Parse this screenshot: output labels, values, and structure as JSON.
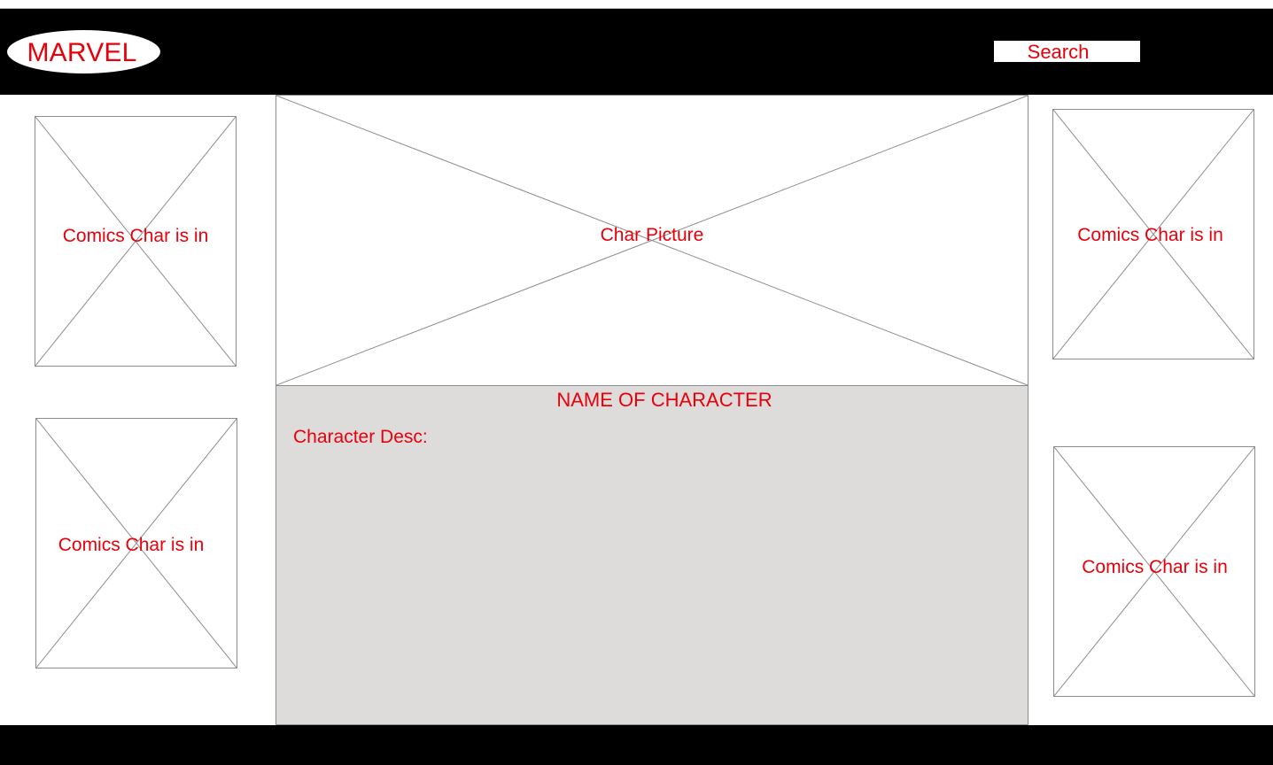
{
  "header": {
    "logo_text": "MARVEL",
    "search_label": "Search"
  },
  "comics": {
    "left_top": "Comics Char is in",
    "left_bottom": "Comics Char is in",
    "right_top": "Comics Char is in",
    "right_bottom": "Comics Char is in"
  },
  "character": {
    "picture_label": "Char Picture",
    "name": "NAME OF CHARACTER",
    "desc_label": "Character Desc:"
  },
  "colors": {
    "bar": "#000000",
    "text_accent": "#e8000b",
    "panel_bg": "#dedbdb"
  }
}
